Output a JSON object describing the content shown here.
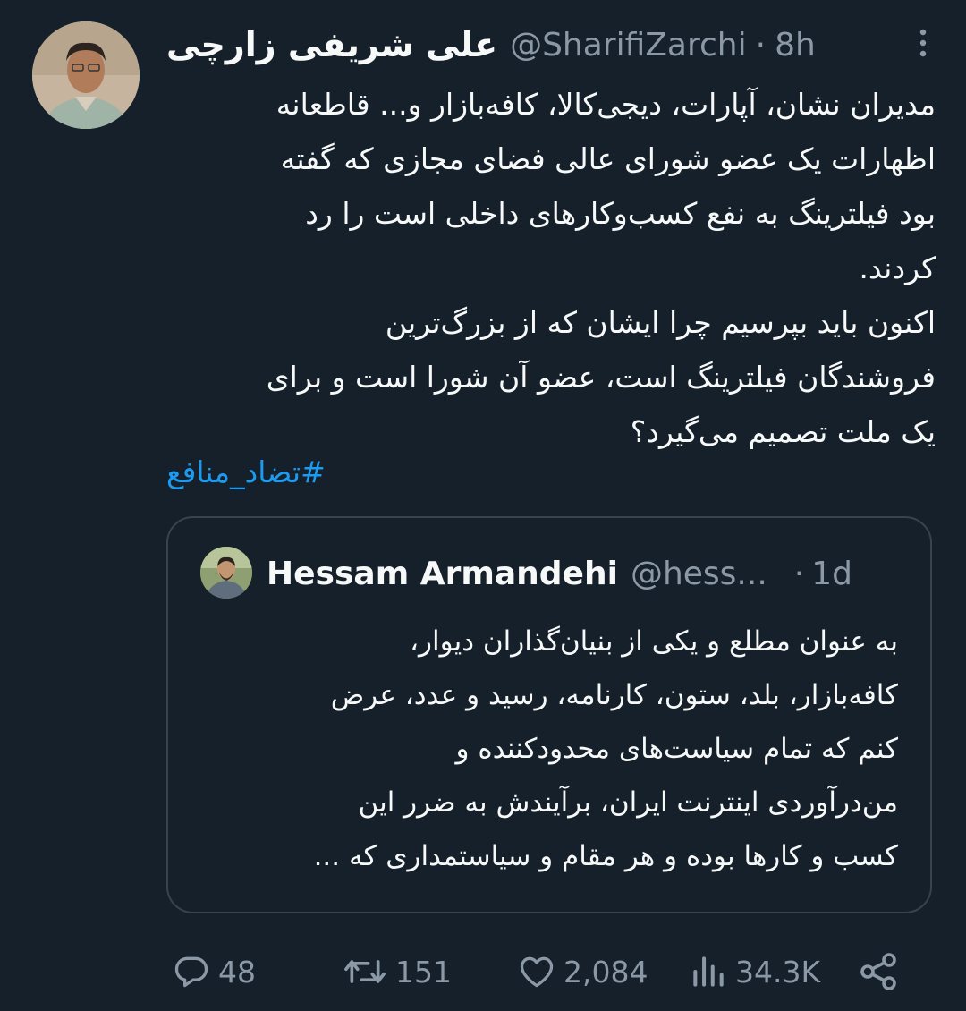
{
  "tweet": {
    "author_name": "علی شریفی زارچی",
    "author_handle": "@SharifiZarchi",
    "separator": "·",
    "time": "8h",
    "text": "مدیران نشان، آپارات، دیجی‌کالا، کافه‌بازار و... قاطعانه\nاظهارات یک عضو شورای عالی فضای مجازی که گفته\nبود فیلترینگ به نفع کسب‌وکارهای داخلی است را رد\nکردند.\nاکنون باید بپرسیم چرا ایشان که از بزرگ‌ترین\nفروشندگان فیلترینگ است، عضو آن شورا است و برای\nیک ملت تصمیم می‌گیرد؟",
    "hashtag": "#تضاد_منافع"
  },
  "quoted": {
    "author_name": "Hessam Armandehi",
    "author_handle": "@hess...",
    "separator": "·",
    "time": "1d",
    "text": "به عنوان مطلع و یکی از بنیان‌گذاران دیوار،\nکافه‌بازار، بلد، ستون، کارنامه، رسید و عدد، عرض\nکنم که تمام سیاست‌های محدودکننده و\nمن‌درآوردی اینترنت ایران، برآیندش به ضرر این\nکسب و کارها بوده و هر مقام و سیاستمداری که ..."
  },
  "actions": {
    "replies": "48",
    "retweets": "151",
    "likes": "2,084",
    "views": "34.3K"
  },
  "icons": {
    "more": "more-vertical-icon",
    "reply": "reply-icon",
    "retweet": "retweet-icon",
    "like": "heart-icon",
    "views": "views-icon",
    "share": "share-icon"
  },
  "colors": {
    "background": "#15202b",
    "text": "#f7f9f9",
    "secondary": "#8b98a5",
    "link": "#1d9bf0",
    "border": "#38444d"
  }
}
